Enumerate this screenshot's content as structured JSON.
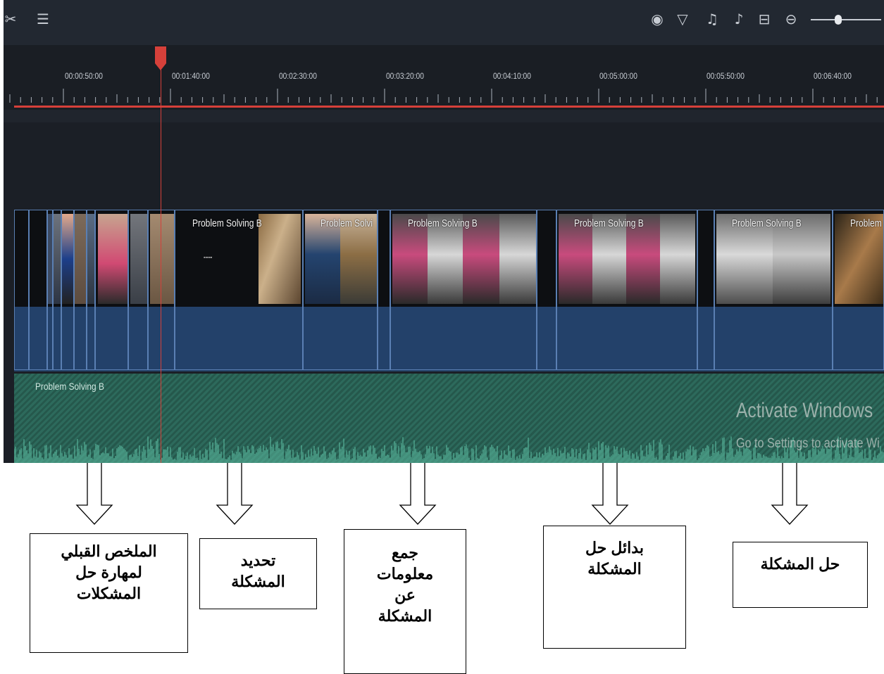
{
  "toolbar": {
    "left_icons": [
      {
        "name": "split-icon",
        "glyph": "✂"
      },
      {
        "name": "audio-mixer-icon",
        "glyph": "☰"
      }
    ],
    "right_icons": [
      {
        "name": "render-preview-icon",
        "glyph": "◉"
      },
      {
        "name": "marker-icon",
        "glyph": "▽"
      },
      {
        "name": "microphone-icon",
        "glyph": "♫"
      },
      {
        "name": "voiceover-icon",
        "glyph": "♪"
      },
      {
        "name": "fit-timeline-icon",
        "glyph": "⊟"
      },
      {
        "name": "zoom-out-icon",
        "glyph": "⊖"
      }
    ],
    "zoom_level": 0.38
  },
  "ruler": {
    "labels": [
      "00:00:50:00",
      "00:01:40:00",
      "00:02:30:00",
      "00:03:20:00",
      "00:04:10:00",
      "00:05:00:00",
      "00:05:50:00",
      "00:06:40:00"
    ]
  },
  "video_track": {
    "clip_title": "Problem Solving B",
    "clips": [
      {
        "title": ""
      },
      {
        "title": ""
      },
      {
        "title": ""
      },
      {
        "title": ""
      },
      {
        "title": ""
      },
      {
        "title": ""
      },
      {
        "title": ""
      },
      {
        "title": ""
      },
      {
        "title": ""
      },
      {
        "title": ""
      },
      {
        "title": "Problem Solving B"
      },
      {
        "title": "Problem Solvi"
      },
      {
        "title": ""
      },
      {
        "title": "Problem Solving B"
      },
      {
        "title": ""
      },
      {
        "title": "Problem Solving B"
      },
      {
        "title": ""
      },
      {
        "title": "Problem Solving B"
      },
      {
        "title": "Problem"
      }
    ]
  },
  "audio_track": {
    "label": "Problem Solving B"
  },
  "watermark": {
    "title": "Activate Windows",
    "subtitle": "Go to Settings to activate Wi"
  },
  "annotations": [
    {
      "text": "الملخص القبلي\nلمهارة حل\nالمشكلات"
    },
    {
      "text": "تحديد\nالمشكلة"
    },
    {
      "text": "جمع\nمعلومات\nعن\nالمشكلة"
    },
    {
      "text": "بدائل حل\nالمشكلة"
    },
    {
      "text": "حل المشكلة"
    }
  ],
  "colors": {
    "playhead": "#d6403a",
    "video_track": "#244267",
    "audio_track": "#2d6a5c"
  }
}
